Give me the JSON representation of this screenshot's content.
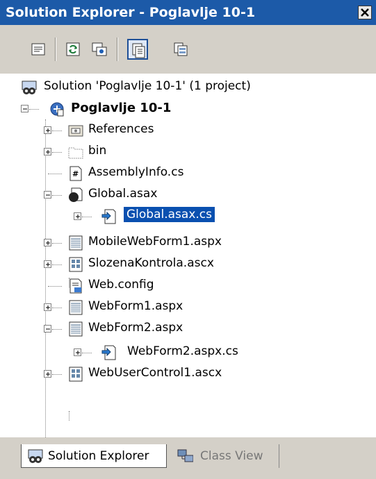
{
  "window": {
    "title": "Solution Explorer - Poglavlje 10-1"
  },
  "toolbar": {
    "buttons": [
      {
        "icon": "properties-icon"
      },
      {
        "icon": "refresh-icon"
      },
      {
        "icon": "show-all-files-icon"
      },
      {
        "icon": "view-code-icon"
      },
      {
        "icon": "view-designer-icon"
      }
    ]
  },
  "tree": {
    "solution": "Solution 'Poglavlje 10-1' (1 project)",
    "project": "Poglavlje 10-1",
    "items": [
      "References",
      "bin",
      "AssemblyInfo.cs",
      "Global.asax",
      "Global.asax.cs",
      "MobileWebForm1.aspx",
      "SlozenaKontrola.ascx",
      "Web.config",
      "WebForm1.aspx",
      "WebForm2.aspx",
      "WebForm2.aspx.cs",
      "WebUserControl1.ascx"
    ]
  },
  "tabs": {
    "solution_explorer": "Solution Explorer",
    "class_view": "Class View"
  },
  "colors": {
    "title_bar": "#1c5aa8",
    "selection": "#0a50b0",
    "panel": "#d4d0c8"
  }
}
